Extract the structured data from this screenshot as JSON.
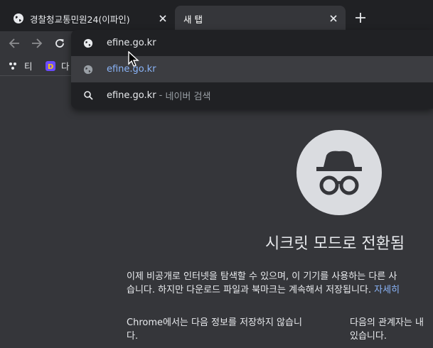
{
  "tabs": [
    {
      "title": "경찰청교통민원24(이파인)",
      "active": false
    },
    {
      "title": "새 탭",
      "active": true
    }
  ],
  "bookmarks": [
    {
      "label": "티"
    },
    {
      "label": "다"
    }
  ],
  "omnibox": {
    "input_text": "efine.go.kr",
    "suggestions": [
      {
        "text": "efine.go.kr",
        "selected": true
      },
      {
        "text": "efine.go.kr",
        "separator": " - ",
        "suffix": "네이버 검색"
      }
    ]
  },
  "incognito": {
    "title": "시크릿 모드로 전환됨",
    "para1_line1": "이제 비공개로 인터넷을 탐색할 수 있으며, 이 기기를 사용하는 다른 사",
    "para1_line2": "습니다. 하지만 다운로드 파일과 북마크는 계속해서 저장됩니다.",
    "learn_more": "자세히",
    "left_col_line1": "Chrome에서는 다음 정보를 저장하지 않습니",
    "left_col_line2": "다.",
    "right_col_line1": "다음의 관계자는 내",
    "right_col_line2": "있습니다."
  },
  "colors": {
    "background": "#35363a",
    "tab_strip": "#202124",
    "link": "#8ab4f8"
  }
}
